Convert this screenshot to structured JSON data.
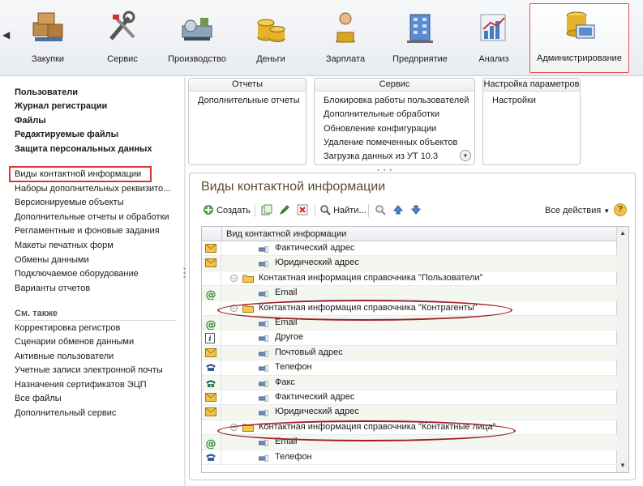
{
  "toolbar": {
    "items": [
      {
        "label": "Закупки",
        "icon": "boxes-icon"
      },
      {
        "label": "Сервис",
        "icon": "tools-icon"
      },
      {
        "label": "Производство",
        "icon": "machine-icon"
      },
      {
        "label": "Деньги",
        "icon": "coins-icon"
      },
      {
        "label": "Зарплата",
        "icon": "worker-icon"
      },
      {
        "label": "Предприятие",
        "icon": "building-icon"
      },
      {
        "label": "Анализ",
        "icon": "chart-icon"
      },
      {
        "label": "Администрирование",
        "icon": "admin-icon",
        "selected": true
      }
    ]
  },
  "left": {
    "bold_links": [
      "Пользователи",
      "Журнал регистрации",
      "Файлы",
      "Редактируемые файлы",
      "Защита персональных данных"
    ],
    "links": [
      "Виды контактной информации",
      "Наборы дополнительных реквизито...",
      "Версионируемые объекты",
      "Дополнительные отчеты и обработки",
      "Регламентные и фоновые задания",
      "Макеты печатных форм",
      "Обмены данными",
      "Подключаемое оборудование",
      "Варианты отчетов"
    ],
    "see_also_title": "См. также",
    "see_also": [
      "Корректировка регистров",
      "Сценарии обменов данными",
      "Активные пользователи",
      "Учетные записи электронной почты",
      "Назначения сертификатов ЭЦП",
      "Все файлы",
      "Дополнительный сервис"
    ]
  },
  "groups": {
    "reports": {
      "title": "Отчеты",
      "items": [
        "Дополнительные отчеты"
      ]
    },
    "service": {
      "title": "Сервис",
      "items": [
        "Блокировка работы пользователей",
        "Дополнительные обработки",
        "Обновление конфигурации",
        "Удаление помеченных объектов",
        "Загрузка данных из УТ 10.3"
      ]
    },
    "settings": {
      "title": "Настройка параметров",
      "items": [
        "Настройки"
      ]
    }
  },
  "main": {
    "title": "Виды контактной информации",
    "create_label": "Создать",
    "find_label": "Найти...",
    "all_actions_label": "Все действия",
    "help_label": "?",
    "column_header": "Вид контактной информации",
    "rows": [
      {
        "text": "Фактический адрес",
        "type": "item",
        "icon": "envelope-icon"
      },
      {
        "text": "Юридический адрес",
        "type": "item",
        "icon": "envelope-icon"
      },
      {
        "text": "Контактная информация справочника \"Пользователи\"",
        "type": "group"
      },
      {
        "text": "Email",
        "type": "item",
        "icon": "at-icon"
      },
      {
        "text": "Контактная информация справочника \"Контрагенты\"",
        "type": "group",
        "highlighted": true
      },
      {
        "text": "Email",
        "type": "item",
        "icon": "at-icon"
      },
      {
        "text": "Другое",
        "type": "item",
        "icon": "info-icon"
      },
      {
        "text": "Почтовый адрес",
        "type": "item",
        "icon": "envelope-icon"
      },
      {
        "text": "Телефон",
        "type": "item",
        "icon": "phone-icon"
      },
      {
        "text": "Факс",
        "type": "item",
        "icon": "fax-icon"
      },
      {
        "text": "Фактический адрес",
        "type": "item",
        "icon": "envelope-icon"
      },
      {
        "text": "Юридический адрес",
        "type": "item",
        "icon": "envelope-icon"
      },
      {
        "text": "Контактная информация справочника \"Контактные лица\"",
        "type": "group",
        "highlighted": true
      },
      {
        "text": "Email",
        "type": "item",
        "icon": "at-icon"
      },
      {
        "text": "Телефон",
        "type": "item",
        "icon": "phone-icon"
      }
    ]
  },
  "colors": {
    "highlight_box": "#e03030",
    "ellipse": "#9c1f2a",
    "title": "#5b4a2d",
    "row_alt": "#f3f7f0"
  }
}
